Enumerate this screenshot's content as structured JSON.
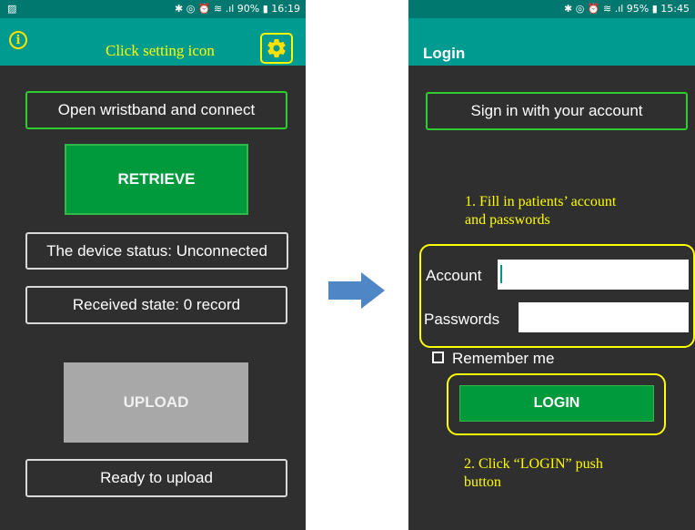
{
  "left_screen": {
    "statusbar": {
      "left_icon": "image-icon",
      "right_text": "✱ ◎ ⏰ ≋ .ıl 90% ▮ 16:19"
    },
    "annotation_title": "Click setting icon",
    "info_icon": "info-icon",
    "settings_icon": "gear-icon",
    "open_label": "Open wristband and connect",
    "retrieve_label": "RETRIEVE",
    "device_status": "The device status: Unconnected",
    "received_state": "Received state: 0 record",
    "upload_label": "UPLOAD",
    "ready_label": "Ready to upload"
  },
  "right_screen": {
    "statusbar": {
      "right_text": "✱ ◎ ⏰ ≋ .ıl 95% ▮ 15:45"
    },
    "title": "Login",
    "sign_in_label": "Sign in with your account",
    "hint1_line1": "1. Fill in patients’ account",
    "hint1_line2": "and passwords",
    "account_label": "Account",
    "account_value": "",
    "password_label": "Passwords",
    "password_value": "",
    "remember_label": "Remember me",
    "remember_checked": false,
    "login_label": "LOGIN",
    "hint2_line1": "2. Click “LOGIN” push",
    "hint2_line2": "button"
  },
  "colors": {
    "appbar": "#009b90",
    "statusbar": "#00786f",
    "background": "#2f2f2f",
    "button_green": "#009a3c",
    "highlight": "#ffff00"
  }
}
